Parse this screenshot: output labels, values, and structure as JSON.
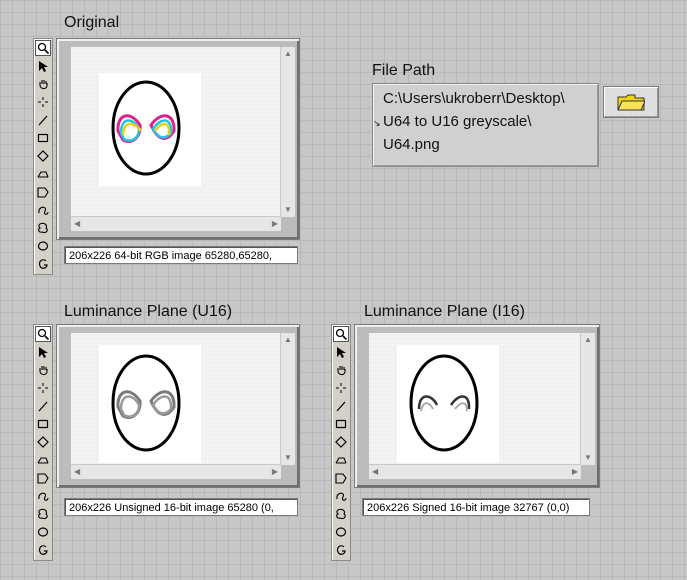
{
  "labels": {
    "original": "Original",
    "file_path": "File Path",
    "luminance_u16": "Luminance Plane (U16)",
    "luminance_i16": "Luminance Plane (I16)"
  },
  "file_path": {
    "value_lines": [
      "C:\\Users\\ukroberr\\Desktop\\",
      "U64 to U16 greyscale\\",
      "U64.png"
    ]
  },
  "status": {
    "original": "206x226 64-bit RGB image 65280,65280,",
    "u16": "206x226 Unsigned 16-bit image 65280     (0,",
    "i16": "206x226 Signed 16-bit image 32767     (0,0)"
  },
  "palette_tools": [
    "zoom-icon",
    "pointer-icon",
    "pan-icon",
    "crosshair-icon",
    "line-icon",
    "rectangle-icon",
    "rotated-rect-icon",
    "annulus-icon",
    "polygon-icon",
    "freehand-icon",
    "freehand-region-icon",
    "oval-icon",
    "broken-line-icon"
  ],
  "colors": {
    "mask_magenta": "#e0208e",
    "mask_cyan": "#1fc6e6",
    "mask_yellow": "#e6d21a",
    "browse_folder": "#f2d40e"
  }
}
